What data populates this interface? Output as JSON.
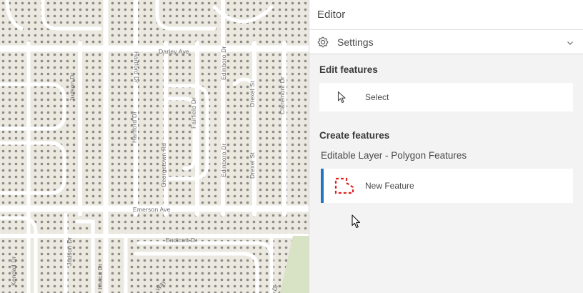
{
  "map": {
    "streets": {
      "darley": "Darley Ave",
      "hartford_top": "Hartford Dr",
      "hartford_mid": "Hartford Dr",
      "judson_top": "Judson Dr",
      "judson_bottom": "Judson Dr",
      "edinboro_top": "Edinboro Dr",
      "edinboro_mid": "Edinboro Dr",
      "fairfield": "Fairfield Dr",
      "drexel_top": "Drexel St",
      "drexel_mid": "Drexel St",
      "claremont": "Claremont Dr",
      "georgetown": "Georgetown Rd",
      "emerson": "Emerson Ave",
      "endicott": "Endicott Dr",
      "kendall": "Kendall Dr",
      "ithaca": "Ithaca Dr",
      "way": "Way",
      "dr": "Dr"
    }
  },
  "panel": {
    "title": "Editor",
    "settings": {
      "label": "Settings",
      "icon": "gear-icon",
      "chevron": "chevron-down-icon"
    },
    "edit_features": {
      "heading": "Edit features",
      "select": {
        "label": "Select",
        "icon": "pointer-icon"
      }
    },
    "create_features": {
      "heading": "Create features",
      "layer_title": "Editable Layer - Polygon Features",
      "template": {
        "label": "New Feature",
        "icon": "dashed-polygon-icon",
        "accent": "#1f76c2",
        "symbol_color": "#e0201d"
      }
    }
  }
}
